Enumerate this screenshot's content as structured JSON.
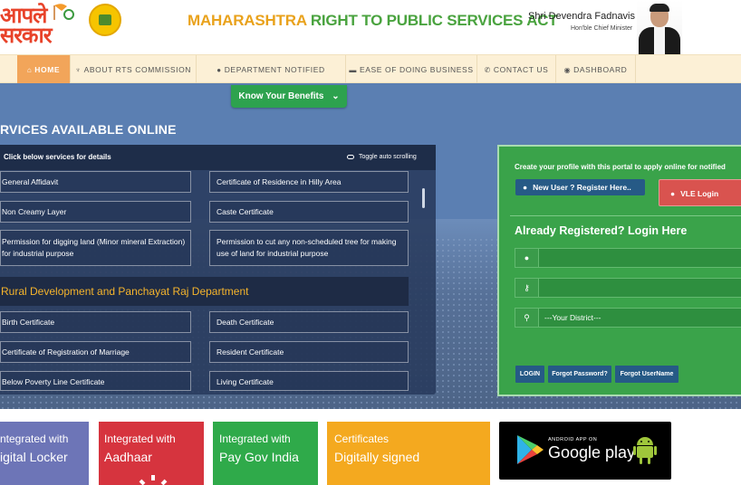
{
  "header": {
    "logo_line1": "आपले",
    "logo_line2": "सरकार",
    "title_part1": "MAHARASHTRA",
    "title_part2": "RIGHT TO PUBLIC SERVICES ACT",
    "cm_name": "Shri Devendra Fadnavis",
    "cm_role": "Hon'ble Chief Minister"
  },
  "nav": {
    "items": [
      {
        "label": "HOME",
        "icon": "home-icon"
      },
      {
        "label": "ABOUT RTS COMMISSION",
        "icon": "lightbulb-icon"
      },
      {
        "label": "DEPARTMENT NOTIFIED SERVICES",
        "icon": "user-icon"
      },
      {
        "label": "EASE OF DOING BUSINESS",
        "icon": "briefcase-icon"
      },
      {
        "label": "CONTACT US",
        "icon": "phone-icon"
      },
      {
        "label": "DASHBOARD",
        "icon": "dashboard-icon"
      }
    ]
  },
  "hero": {
    "benefits_label": "Know Your Benefits",
    "heading": "RVICES AVAILABLE ONLINE"
  },
  "services": {
    "click_text": "Click below services for details",
    "toggle_text": "Toggle auto scrolling",
    "rows": [
      {
        "left": "General Affidavit",
        "right": "Certificate of Residence in Hilly Area"
      },
      {
        "left": "Non Creamy Layer",
        "right": "Caste Certificate"
      },
      {
        "left": "Permission for digging land (Minor mineral Extraction) for industrial purpose",
        "right": "Permission to cut any non-scheduled tree for making use of land for industrial purpose"
      }
    ],
    "department": "Rural Development and Panchayat Raj Department",
    "rows2": [
      {
        "left": "Birth Certificate",
        "right": "Death Certificate"
      },
      {
        "left": "Certificate of Registration of Marriage",
        "right": "Resident Certificate"
      },
      {
        "left": "Below Poverty Line Certificate",
        "right": "Living Certificate"
      }
    ]
  },
  "login": {
    "create_text": "Create your profile with this portal to apply online for notified",
    "new_user_label": "New User ? Register Here..",
    "vle_label": "VLE Login",
    "title": "Already Registered? Login Here",
    "district_placeholder": "---Your District---",
    "login_btn": "LOGIN",
    "forgot_password": "Forgot Password?",
    "forgot_username": "Forgot UserName"
  },
  "tiles": [
    {
      "line1": "ntegrated with",
      "line2": "igital Locker",
      "color": "#6d75b7"
    },
    {
      "line1": "Integrated with",
      "line2": "Aadhaar",
      "color": "#d6343e"
    },
    {
      "line1": "Integrated with",
      "line2": "Pay Gov India",
      "color": "#2faa4a"
    },
    {
      "line1": "Certificates",
      "line2": "Digitally signed",
      "color": "#f4a91f"
    }
  ],
  "gplay": {
    "small": "ANDROID APP ON",
    "big": "Google play"
  }
}
